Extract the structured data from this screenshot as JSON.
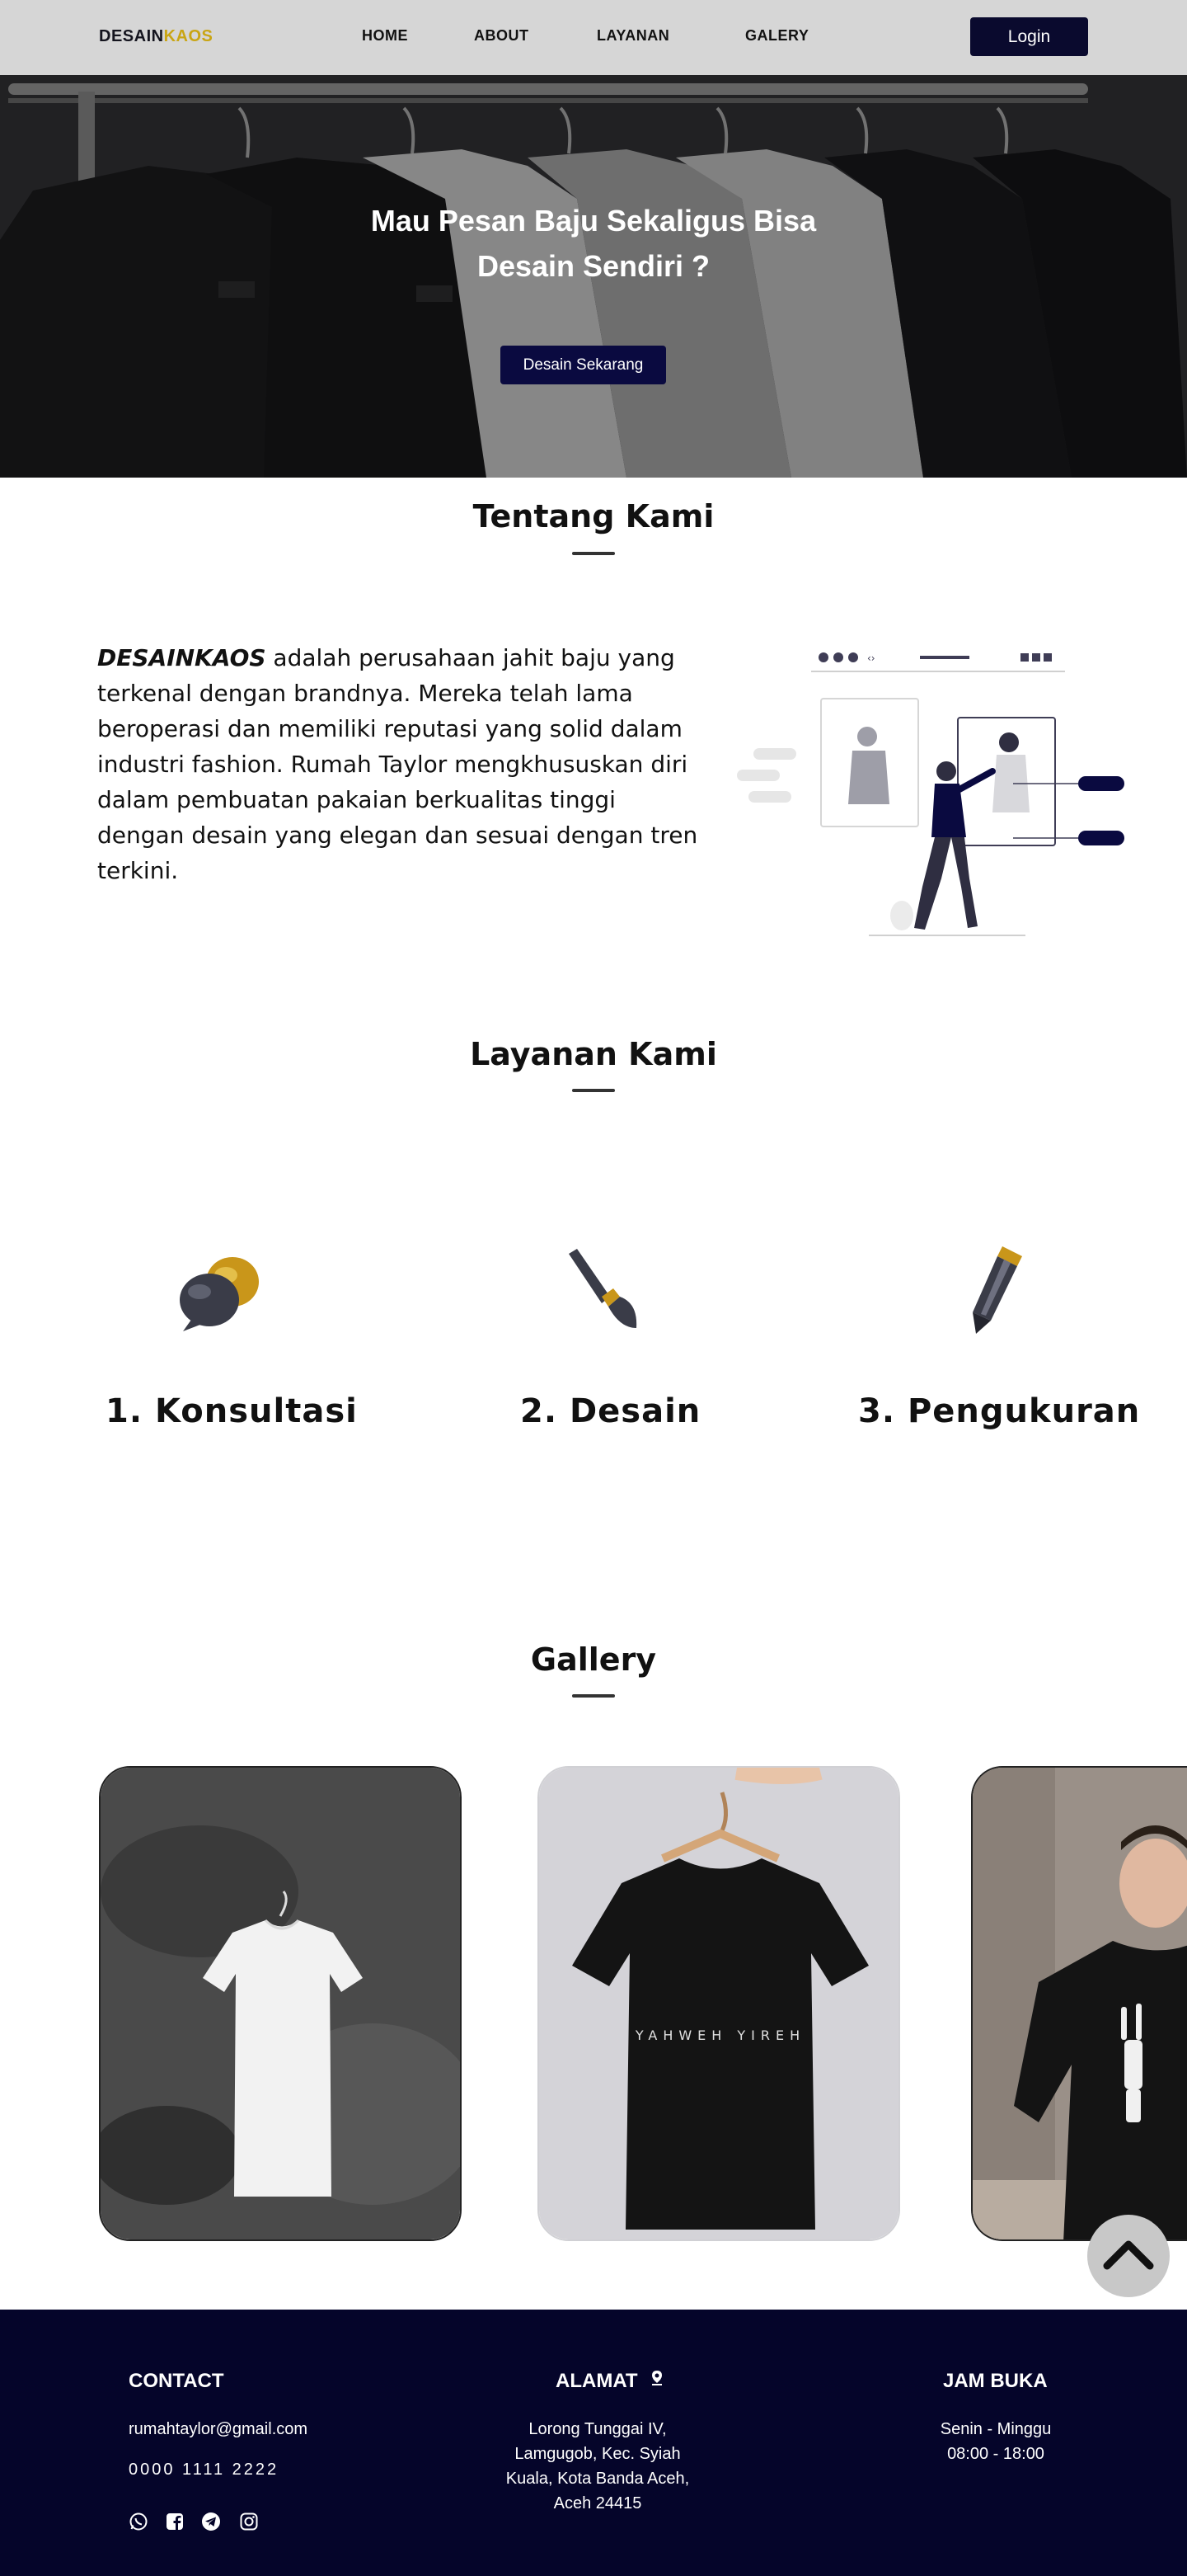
{
  "navbar": {
    "brand_part1": "DESAIN",
    "brand_part2": "KAOS",
    "links": [
      "HOME",
      "ABOUT",
      "LAYANAN",
      "GALERY"
    ],
    "login_label": "Login"
  },
  "hero": {
    "title_line1": "Mau Pesan Baju Sekaligus Bisa",
    "title_line2": "Desain Sendiri ?",
    "button_label": "Desain Sekarang"
  },
  "about": {
    "title": "Tentang Kami",
    "brand_em": "DESAINKAOS",
    "body": " adalah perusahaan jahit baju yang terkenal dengan brandnya. Mereka telah lama beroperasi dan memiliki reputasi yang solid dalam industri fashion. Rumah Taylor mengkhususkan diri dalam pembuatan pakaian berkualitas tinggi dengan desain yang elegan dan sesuai dengan tren terkini."
  },
  "services": {
    "title": "Layanan Kami",
    "items": [
      {
        "label": "1. Konsultasi",
        "icon": "chat-bubbles-icon"
      },
      {
        "label": "2. Desain",
        "icon": "paintbrush-icon"
      },
      {
        "label": "3. Pengukuran",
        "icon": "pencil-icon"
      }
    ]
  },
  "gallery": {
    "title": "Gallery",
    "items": [
      {
        "icon": "white-tshirt-photo"
      },
      {
        "icon": "black-tshirt-photo",
        "shirt_text": "YAHWEH YIREH"
      },
      {
        "icon": "model-tshirt-photo"
      }
    ]
  },
  "footer": {
    "contact_title": "CONTACT",
    "email": "rumahtaylor@gmail.com",
    "phone": "0000 1111  2222",
    "address_title": "ALAMAT",
    "address_lines": [
      "Lorong Tunggai IV,",
      "Lamgugob, Kec. Syiah",
      "Kuala, Kota Banda Aceh,",
      "Aceh 24415"
    ],
    "hours_title": "JAM BUKA",
    "hours_days": "Senin - Minggu",
    "hours_time": "08:00 - 18:00",
    "social_icons": [
      "whatsapp-icon",
      "facebook-icon",
      "telegram-icon",
      "instagram-icon"
    ]
  },
  "colors": {
    "navbar_bg": "#d6d6d6",
    "brand_gold": "#c9a514",
    "primary_navy": "#0a0a2e",
    "footer_bg": "#05052a"
  }
}
